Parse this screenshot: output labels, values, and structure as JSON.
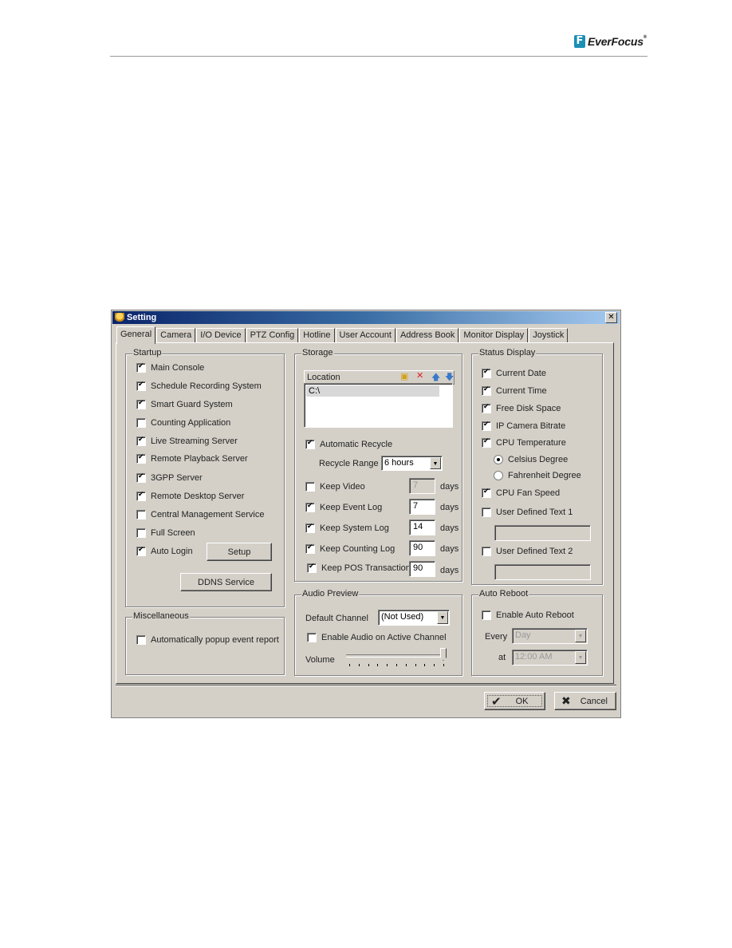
{
  "brand": {
    "name": "EverFocus",
    "mark": "F",
    "registered": "®"
  },
  "dialog": {
    "title": "Setting",
    "close_label": "✕",
    "tabs": [
      {
        "label": "General",
        "active": true
      },
      {
        "label": "Camera"
      },
      {
        "label": "I/O Device"
      },
      {
        "label": "PTZ Config"
      },
      {
        "label": "Hotline"
      },
      {
        "label": "User Account"
      },
      {
        "label": "Address Book"
      },
      {
        "label": "Monitor Display"
      },
      {
        "label": "Joystick"
      }
    ],
    "startup": {
      "title": "Startup",
      "items": [
        {
          "label": "Main Console",
          "checked": true
        },
        {
          "label": "Schedule Recording System",
          "checked": true
        },
        {
          "label": "Smart Guard System",
          "checked": true
        },
        {
          "label": "Counting Application",
          "checked": false
        },
        {
          "label": "Live Streaming Server",
          "checked": true
        },
        {
          "label": "Remote Playback Server",
          "checked": true
        },
        {
          "label": "3GPP Server",
          "checked": true
        },
        {
          "label": "Remote Desktop Server",
          "checked": true
        },
        {
          "label": "Central Management Service",
          "checked": false
        },
        {
          "label": "Full Screen",
          "checked": false
        },
        {
          "label": "Auto Login",
          "checked": true
        }
      ],
      "setup_button": "Setup",
      "ddns_button": "DDNS Service"
    },
    "misc": {
      "title": "Miscellaneous",
      "items": [
        {
          "label": "Automatically popup event report",
          "checked": false
        }
      ]
    },
    "storage": {
      "title": "Storage",
      "location_header": "Location",
      "icons": [
        "folder-icon",
        "delete-icon",
        "move-up-icon",
        "move-down-icon"
      ],
      "locations": [
        "C:\\"
      ],
      "automatic_recycle": {
        "label": "Automatic Recycle",
        "checked": true
      },
      "recycle_range_label": "Recycle Range",
      "recycle_range_value": "6 hours",
      "keep": [
        {
          "label": "Keep Video",
          "checked": false,
          "value": "7",
          "enabled": false,
          "unit": "days"
        },
        {
          "label": "Keep Event Log",
          "checked": true,
          "value": "7",
          "enabled": true,
          "unit": "days"
        },
        {
          "label": "Keep System Log",
          "checked": true,
          "value": "14",
          "enabled": true,
          "unit": "days"
        },
        {
          "label": "Keep Counting Log",
          "checked": true,
          "value": "90",
          "enabled": true,
          "unit": "days"
        },
        {
          "label": "Keep POS Transaction",
          "checked": true,
          "value": "90",
          "enabled": true,
          "unit": "days"
        }
      ]
    },
    "audio": {
      "title": "Audio Preview",
      "default_channel_label": "Default Channel",
      "default_channel_value": "(Not Used)",
      "enable_active": {
        "label": "Enable Audio on Active Channel",
        "checked": false
      },
      "volume_label": "Volume",
      "volume_percent": 100
    },
    "status": {
      "title": "Status Display",
      "items": [
        {
          "label": "Current Date",
          "checked": true
        },
        {
          "label": "Current Time",
          "checked": true
        },
        {
          "label": "Free Disk Space",
          "checked": true
        },
        {
          "label": "IP Camera Bitrate",
          "checked": true
        },
        {
          "label": "CPU Temperature",
          "checked": true
        }
      ],
      "temp_units": [
        {
          "label": "Celsius Degree",
          "selected": true
        },
        {
          "label": "Fahrenheit Degree",
          "selected": false
        }
      ],
      "cpu_fan": {
        "label": "CPU Fan Speed",
        "checked": true
      },
      "user_text_1": {
        "label": "User Defined Text 1",
        "checked": false,
        "value": ""
      },
      "user_text_2": {
        "label": "User Defined Text 2",
        "checked": false,
        "value": ""
      }
    },
    "reboot": {
      "title": "Auto Reboot",
      "enable": {
        "label": "Enable Auto Reboot",
        "checked": false
      },
      "every_label": "Every",
      "every_value": "Day",
      "at_label": "at",
      "at_value": "12:00 AM"
    },
    "ok_label": "OK",
    "cancel_label": "Cancel"
  }
}
